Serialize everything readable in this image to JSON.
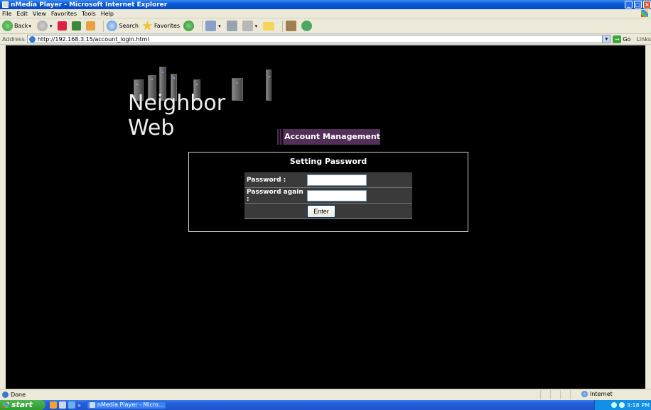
{
  "window": {
    "title": "nMedia Player - Microsoft Internet Explorer",
    "controls": [
      "minimize",
      "maximize",
      "close"
    ]
  },
  "menu": [
    "File",
    "Edit",
    "View",
    "Favorites",
    "Tools",
    "Help"
  ],
  "toolbar": {
    "back_label": "Back",
    "search_label": "Search",
    "favorites_label": "Favorites"
  },
  "address": {
    "label": "Address",
    "url": "http://192.168.3.15/account_login.html",
    "go_label": "Go",
    "links_label": "Links"
  },
  "page": {
    "logo_text": "Neighbor Web",
    "section_header": "Account Management",
    "panel_title": "Setting Password",
    "fields": [
      {
        "label": "Password :",
        "value": ""
      },
      {
        "label": "Password again :",
        "value": ""
      }
    ],
    "enter_button": "Enter"
  },
  "status": {
    "text": "Done",
    "zone": "Internet"
  },
  "taskbar": {
    "start_label": "start",
    "task_label": "nMedia Player - Micro...",
    "clock": "3:18 PM"
  },
  "colors": {
    "page_background": "#000000",
    "header_accent": "#53305a"
  },
  "icons": [
    "back-icon",
    "forward-icon",
    "stop-icon",
    "refresh-icon",
    "home-icon",
    "search-icon",
    "favorites-icon",
    "media-icon",
    "mail-icon",
    "print-icon",
    "edit-icon",
    "folder-icon",
    "research-icon",
    "messenger-icon",
    "go-icon",
    "globe-icon"
  ]
}
